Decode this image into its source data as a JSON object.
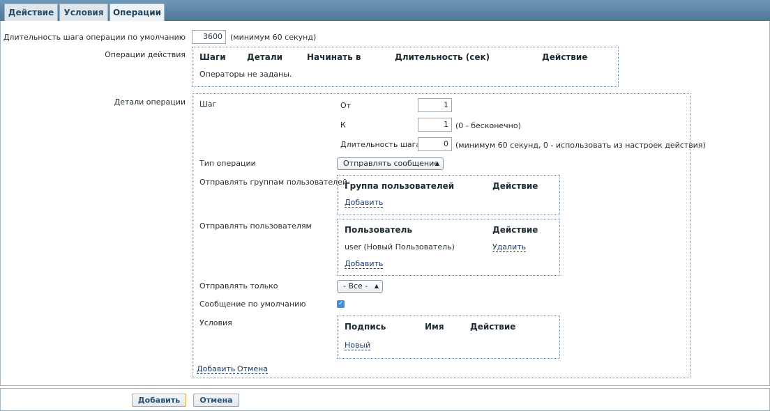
{
  "tabs": [
    {
      "label": "Действие"
    },
    {
      "label": "Условия"
    },
    {
      "label": "Операции"
    }
  ],
  "default_step": {
    "label": "Длительность шага операции по умолчанию",
    "value": "3600",
    "hint": "(минимум 60 секунд)"
  },
  "action_ops": {
    "label": "Операции действия",
    "columns": [
      "Шаги",
      "Детали",
      "Начинать в",
      "Длительность (сек)",
      "Действие"
    ],
    "empty_text": "Операторы не заданы."
  },
  "details": {
    "label": "Детали операции",
    "step_label": "Шаг",
    "from_label": "От",
    "from_value": "1",
    "to_label": "К",
    "to_value": "1",
    "to_hint": "(0 - бесконечно)",
    "duration_label": "Длительность шага",
    "duration_value": "0",
    "duration_hint": "(минимум 60 секунд, 0 - использовать из настроек действия)",
    "optype_label": "Тип операции",
    "optype_value": "Отправлять сообщение",
    "groups_label": "Отправлять группам пользователей",
    "groups_columns": [
      "Группа пользователей",
      "Действие"
    ],
    "groups_add": "Добавить",
    "users_label": "Отправлять пользователям",
    "users_columns": [
      "Пользователь",
      "Действие"
    ],
    "users_rows": [
      {
        "name": "user (Новый Пользователь)",
        "action": "Удалить"
      }
    ],
    "users_add": "Добавить",
    "sendonly_label": "Отправлять только",
    "sendonly_value": "- Все -",
    "defmsg_label": "Сообщение по умолчанию",
    "cond_label": "Условия",
    "cond_columns": [
      "Подпись",
      "Имя",
      "Действие"
    ],
    "cond_new": "Новый",
    "add_link": "Добавить",
    "cancel_link": "Отмена"
  },
  "footer": {
    "add": "Добавить",
    "cancel": "Отмена"
  },
  "colors": {
    "tabbar": "#5a83a3",
    "link": "#1c3b66",
    "checkbox": "#3a8ee6"
  }
}
